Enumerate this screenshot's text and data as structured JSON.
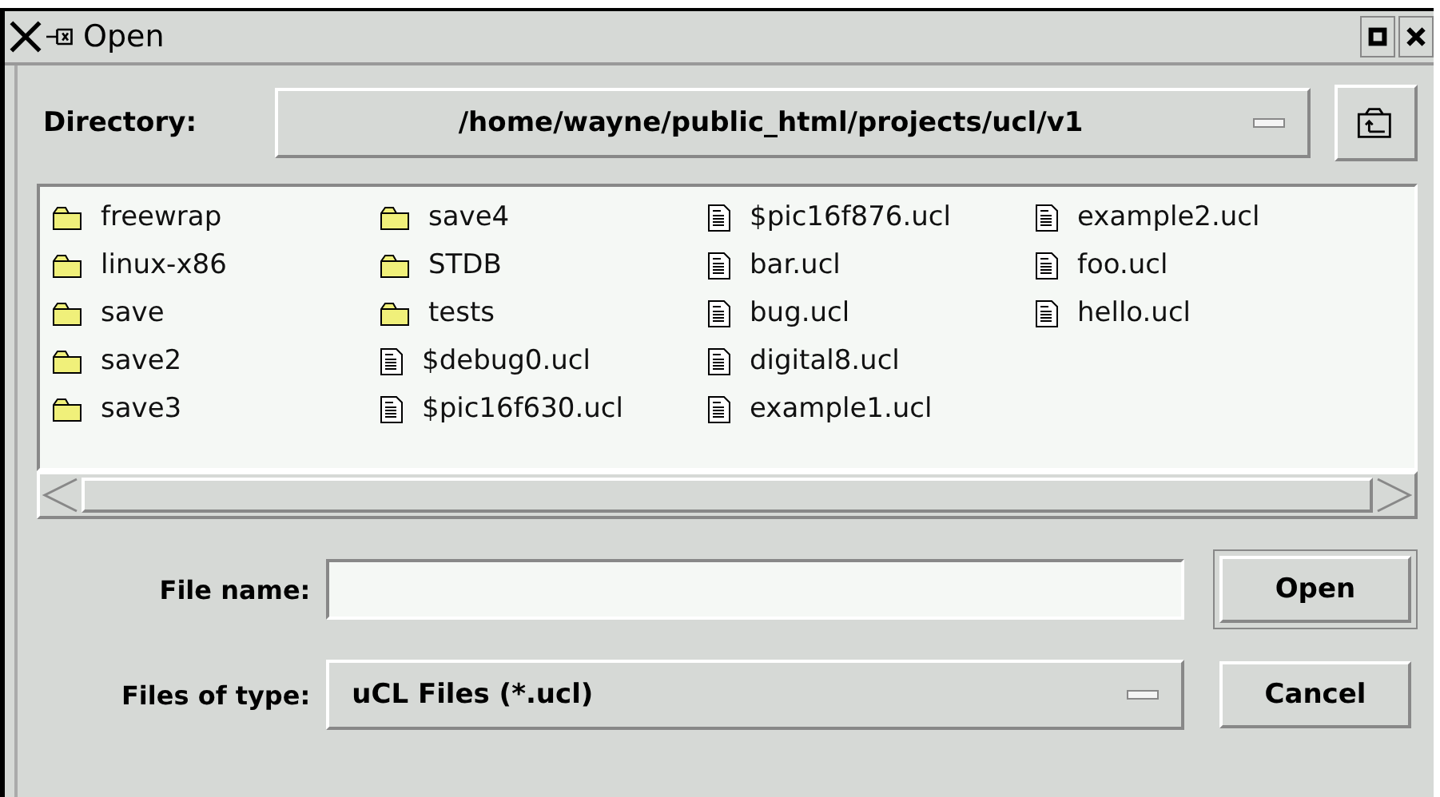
{
  "window": {
    "title": "Open"
  },
  "directory": {
    "label": "Directory:",
    "value": "/home/wayne/public_html/projects/ucl/v1"
  },
  "files": [
    {
      "name": "freewrap",
      "kind": "folder"
    },
    {
      "name": "linux-x86",
      "kind": "folder"
    },
    {
      "name": "save",
      "kind": "folder"
    },
    {
      "name": "save2",
      "kind": "folder"
    },
    {
      "name": "save3",
      "kind": "folder"
    },
    {
      "name": "save4",
      "kind": "folder"
    },
    {
      "name": "STDB",
      "kind": "folder"
    },
    {
      "name": "tests",
      "kind": "folder"
    },
    {
      "name": "$debug0.ucl",
      "kind": "file"
    },
    {
      "name": "$pic16f630.ucl",
      "kind": "file"
    },
    {
      "name": "$pic16f876.ucl",
      "kind": "file"
    },
    {
      "name": "bar.ucl",
      "kind": "file"
    },
    {
      "name": "bug.ucl",
      "kind": "file"
    },
    {
      "name": "digital8.ucl",
      "kind": "file"
    },
    {
      "name": "example1.ucl",
      "kind": "file"
    },
    {
      "name": "example2.ucl",
      "kind": "file"
    },
    {
      "name": "foo.ucl",
      "kind": "file"
    },
    {
      "name": "hello.ucl",
      "kind": "file"
    }
  ],
  "file_name": {
    "label": "File name:"
  },
  "file_type": {
    "label": "Files of type:",
    "value": "uCL Files (*.ucl)"
  },
  "buttons": [
    {
      "label": "Open",
      "default": true
    },
    {
      "label": "Cancel",
      "default": false
    }
  ]
}
